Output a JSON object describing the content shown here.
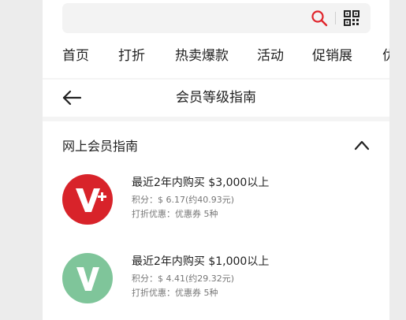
{
  "search": {
    "placeholder": ""
  },
  "nav": {
    "tabs": [
      "首页",
      "打折",
      "热卖爆款",
      "活动",
      "促销展",
      "优"
    ]
  },
  "header": {
    "title": "会员等级指南"
  },
  "section": {
    "title": "网上会员指南"
  },
  "tiers": [
    {
      "badge_letter": "V",
      "badge_suffix": "+",
      "title": "最近2年内购买 $3,000以上",
      "points": "积分：$ 6.17(约40.93元)",
      "discount": "打折优惠：优惠券 5种",
      "badge_color": "#d8232a"
    },
    {
      "badge_letter": "V",
      "badge_suffix": "",
      "title": "最近2年内购买 $1,000以上",
      "points": "积分：$ 4.41(约29.32元)",
      "discount": "打折优惠：优惠券 5种",
      "badge_color": "#7fc59a"
    }
  ],
  "colors": {
    "search_accent": "#e0242b",
    "page_bg": "#f4f4f4"
  }
}
